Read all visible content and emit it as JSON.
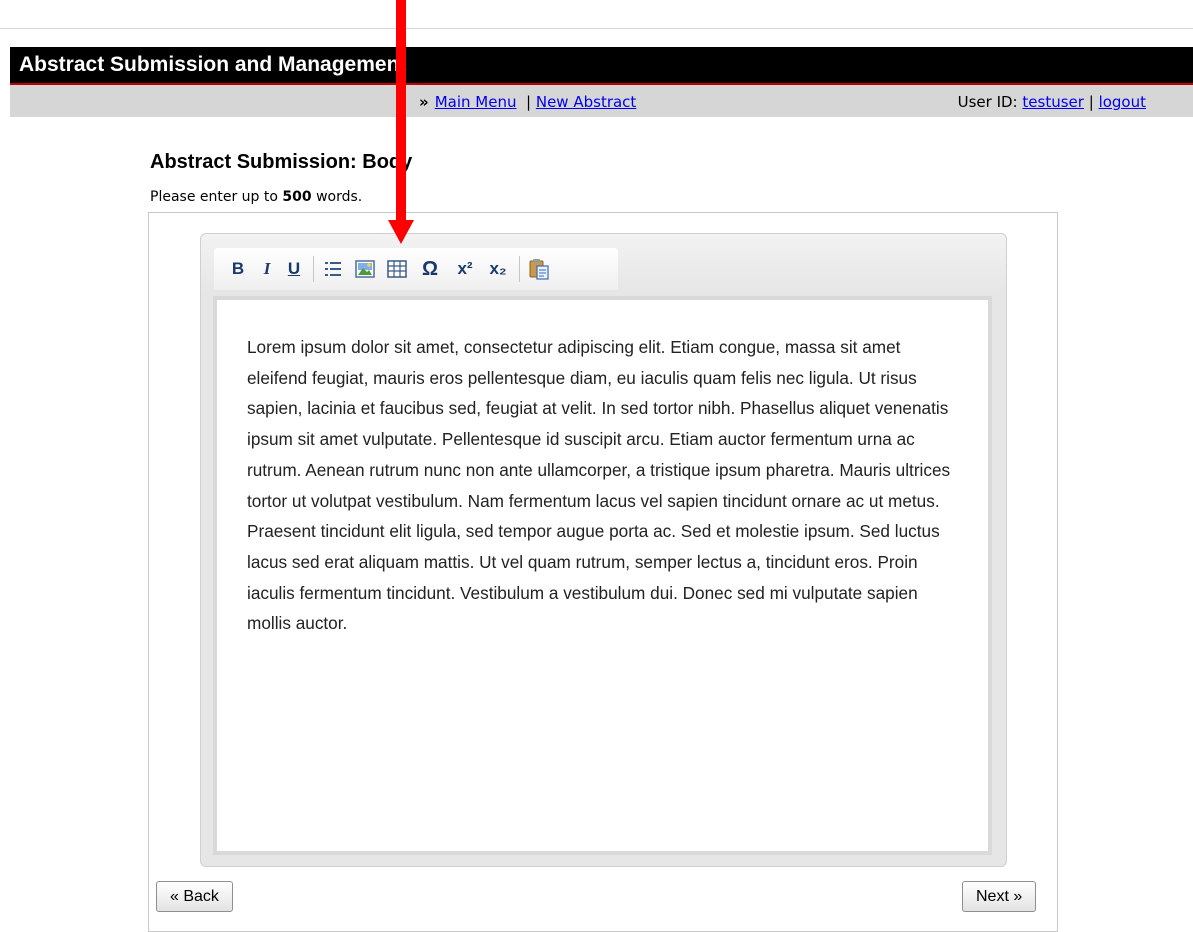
{
  "header": {
    "title": "Abstract Submission and Management"
  },
  "nav": {
    "main_menu": "Main Menu",
    "separator": "|",
    "new_abstract": "New Abstract",
    "user_id_label": "User ID:",
    "user_id_value": "testuser",
    "logout": "logout"
  },
  "page": {
    "title": "Abstract Submission: Body",
    "instructions_prefix": "Please enter up to",
    "word_limit": "500",
    "instructions_suffix": "words."
  },
  "toolbar": {
    "bold": "B",
    "italic": "I",
    "underline": "U",
    "superscript": "x²",
    "subscript": "x₂",
    "special_char": "Ω",
    "icons": [
      "bold-icon",
      "italic-icon",
      "underline-icon",
      "bullet-list-icon",
      "insert-image-icon",
      "insert-table-icon",
      "special-character-icon",
      "superscript-icon",
      "subscript-icon",
      "paste-icon"
    ]
  },
  "editor": {
    "body_text": "Lorem ipsum dolor sit amet, consectetur adipiscing elit. Etiam congue, massa sit amet eleifend feugiat, mauris eros pellentesque diam, eu iaculis quam felis nec ligula. Ut risus sapien, lacinia et faucibus sed, feugiat at velit. In sed tortor nibh. Phasellus aliquet venenatis ipsum sit amet vulputate. Pellentesque id suscipit arcu. Etiam auctor fermentum urna ac rutrum. Aenean rutrum nunc non ante ullamcorper, a tristique ipsum pharetra. Mauris ultrices tortor ut volutpat vestibulum. Nam fermentum lacus vel sapien tincidunt ornare ac ut metus. Praesent tincidunt elit ligula, sed tempor augue porta ac. Sed et molestie ipsum. Sed luctus lacus sed erat aliquam mattis. Ut vel quam rutrum, semper lectus a, tincidunt eros. Proin iaculis fermentum tincidunt. Vestibulum a vestibulum dui. Donec sed mi vulputate sapien mollis auctor."
  },
  "buttons": {
    "back": "« Back",
    "next": "Next »"
  },
  "colors": {
    "header_bg": "#000000",
    "header_border": "#c00000",
    "nav_bg": "#d6d6d6",
    "link": "#0000ee",
    "arrow": "#ff0000"
  }
}
